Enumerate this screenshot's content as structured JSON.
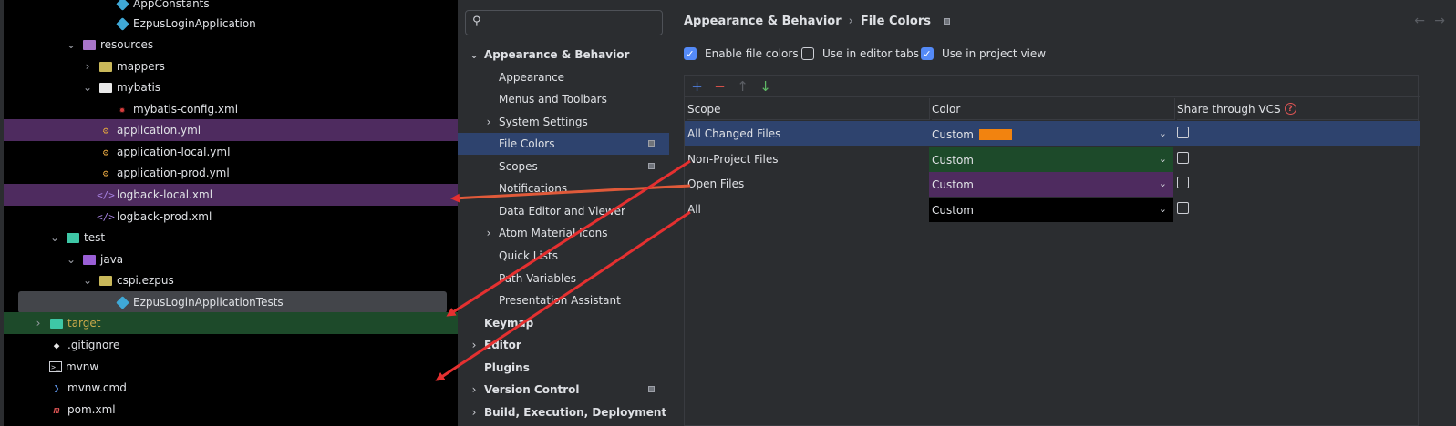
{
  "tree": {
    "rows": [
      {
        "label": "AppConstants",
        "icon": "class-icon"
      },
      {
        "label": "EzpusLoginApplication",
        "icon": "spring-class-icon"
      },
      {
        "label": "resources",
        "icon": "resources-folder-icon"
      },
      {
        "label": "mappers",
        "icon": "folder-icon"
      },
      {
        "label": "mybatis",
        "icon": "folder-icon"
      },
      {
        "label": "mybatis-config.xml",
        "icon": "mybatis-icon"
      },
      {
        "label": "application.yml",
        "icon": "yaml-icon"
      },
      {
        "label": "application-local.yml",
        "icon": "yaml-icon"
      },
      {
        "label": "application-prod.yml",
        "icon": "yaml-icon"
      },
      {
        "label": "logback-local.xml",
        "icon": "xml-icon"
      },
      {
        "label": "logback-prod.xml",
        "icon": "xml-icon"
      },
      {
        "label": "test",
        "icon": "test-folder-icon"
      },
      {
        "label": "java",
        "icon": "test-sources-folder-icon"
      },
      {
        "label": "cspi.ezpus",
        "icon": "package-icon"
      },
      {
        "label": "EzpusLoginApplicationTests",
        "icon": "class-icon"
      },
      {
        "label": "target",
        "icon": "excluded-folder-icon"
      },
      {
        "label": ".gitignore",
        "icon": "git-icon"
      },
      {
        "label": "mvnw",
        "icon": "terminal-icon"
      },
      {
        "label": "mvnw.cmd",
        "icon": "powershell-icon"
      },
      {
        "label": "pom.xml",
        "icon": "maven-icon"
      }
    ]
  },
  "search": {
    "placeholder": "",
    "value": ""
  },
  "nav": {
    "items": [
      {
        "label": "Appearance & Behavior"
      },
      {
        "label": "Appearance"
      },
      {
        "label": "Menus and Toolbars"
      },
      {
        "label": "System Settings"
      },
      {
        "label": "File Colors"
      },
      {
        "label": "Scopes"
      },
      {
        "label": "Notifications"
      },
      {
        "label": "Data Editor and Viewer"
      },
      {
        "label": "Atom Material Icons"
      },
      {
        "label": "Quick Lists"
      },
      {
        "label": "Path Variables"
      },
      {
        "label": "Presentation Assistant"
      },
      {
        "label": "Keymap"
      },
      {
        "label": "Editor"
      },
      {
        "label": "Plugins"
      },
      {
        "label": "Version Control"
      },
      {
        "label": "Build, Execution, Deployment"
      }
    ]
  },
  "panel": {
    "breadcrumb": {
      "parent": "Appearance & Behavior",
      "separator": "›",
      "current": "File Colors"
    },
    "options": {
      "enable_file_colors": {
        "label": "Enable file colors",
        "checked": true
      },
      "use_in_editor_tabs": {
        "label": "Use in editor tabs",
        "checked": false
      },
      "use_in_project_view": {
        "label": "Use in project view",
        "checked": true
      }
    },
    "toolbar": {
      "add": "+",
      "remove": "−",
      "up": "↑",
      "down": "↓"
    },
    "columns": {
      "scope": "Scope",
      "color": "Color",
      "share": "Share through VCS"
    },
    "rows": [
      {
        "scope": "All Changed Files",
        "color": "Custom",
        "swatch": "#f2830f",
        "bg": "",
        "share": false
      },
      {
        "scope": "Non-Project Files",
        "color": "Custom",
        "swatch": "",
        "bg": "#1d4a2a",
        "share": false
      },
      {
        "scope": "Open Files",
        "color": "Custom",
        "swatch": "",
        "bg": "#4e2b5f",
        "share": false
      },
      {
        "scope": "All",
        "color": "Custom",
        "swatch": "",
        "bg": "#000000",
        "share": false
      }
    ]
  },
  "colors": {
    "accent": "#548af7",
    "selection": "#2e436e",
    "annotation_arrow": "#e53030"
  }
}
